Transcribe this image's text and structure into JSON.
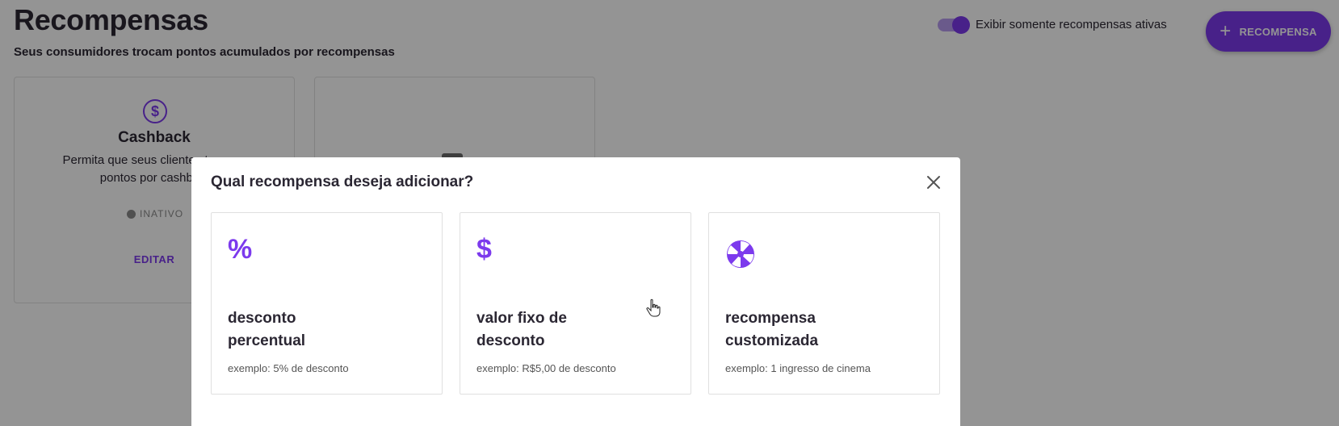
{
  "page": {
    "title": "Recompensas",
    "subtitle": "Seus consumidores trocam pontos acumulados por recompensas"
  },
  "toggle": {
    "label": "Exibir somente recompensas ativas",
    "state": "on"
  },
  "add_button": {
    "icon": "plus-icon",
    "label": "RECOMPENSA"
  },
  "background_cards": [
    {
      "icon": "dollar-circle-icon",
      "title": "Cashback",
      "description": "Permita que seus clientes troquem pontos por cashback",
      "status": "INATIVO",
      "action": "EDITAR"
    }
  ],
  "modal": {
    "title": "Qual recompensa deseja adicionar?",
    "close_icon": "close-icon",
    "options": [
      {
        "icon": "percent-icon",
        "glyph": "%",
        "title": "desconto percentual",
        "example": "exemplo: 5% de desconto"
      },
      {
        "icon": "dollar-icon",
        "glyph": "$",
        "title": "valor fixo de desconto",
        "example": "exemplo: R$5,00 de desconto"
      },
      {
        "icon": "candy-swirl-icon",
        "glyph": "",
        "title": "recompensa customizada",
        "example": "exemplo: 1 ingresso de cinema"
      }
    ]
  },
  "colors": {
    "accent": "#7c3aed",
    "accent_light": "#b79bf0",
    "text": "#2b2733",
    "muted": "#8a8a8a",
    "overlay": "rgba(0,0,0,0.42)"
  }
}
